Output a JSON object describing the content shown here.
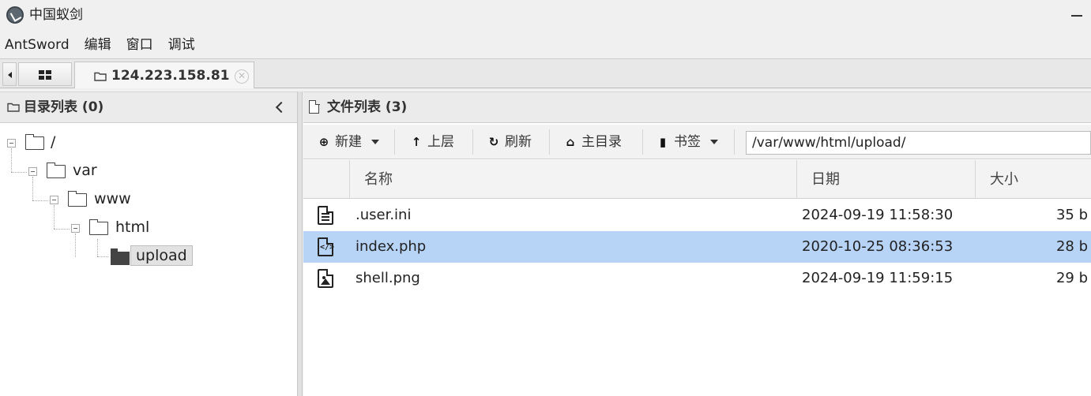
{
  "window": {
    "title": "中国蚁剑",
    "logo_icon": "antsword-logo-icon",
    "minimize_icon": "minimize-icon"
  },
  "menu": [
    "AntSword",
    "编辑",
    "窗口",
    "调试"
  ],
  "tabs": {
    "home_icon": "grid-icon",
    "active": {
      "label": "124.223.158.81",
      "icon": "folder-icon",
      "close_icon": "close-icon"
    }
  },
  "left_panel": {
    "title": "目录列表 (0)",
    "tree": [
      {
        "label": "/",
        "depth": 0
      },
      {
        "label": "var",
        "depth": 1
      },
      {
        "label": "www",
        "depth": 2
      },
      {
        "label": "html",
        "depth": 3
      },
      {
        "label": "upload",
        "depth": 4,
        "selected": true
      }
    ]
  },
  "right_panel": {
    "title": "文件列表 (3)",
    "toolbar": {
      "new_label": "新建",
      "up_label": "上层",
      "refresh_label": "刷新",
      "home_label": "主目录",
      "bookmark_label": "书签",
      "path_value": "/var/www/html/upload/"
    },
    "columns": {
      "name": "名称",
      "date": "日期",
      "size": "大小"
    },
    "files": [
      {
        "name": ".user.ini",
        "date": "2024-09-19 11:58:30",
        "size": "35 b",
        "icon": "text-file-icon",
        "selected": false
      },
      {
        "name": "index.php",
        "date": "2020-10-25 08:36:53",
        "size": "28 b",
        "icon": "code-file-icon",
        "selected": true
      },
      {
        "name": "shell.png",
        "date": "2024-09-19 11:59:15",
        "size": "29 b",
        "icon": "image-file-icon",
        "selected": false
      }
    ]
  },
  "colors": {
    "selection": "#b7d4f7",
    "panel_header": "#ebebeb"
  }
}
